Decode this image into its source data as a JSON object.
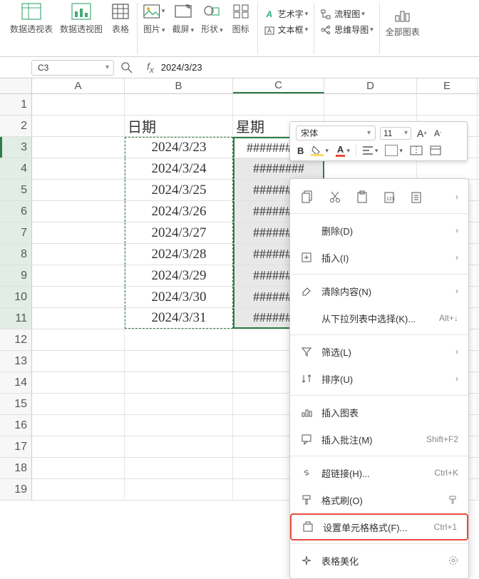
{
  "ribbon": {
    "pivot_table": "数据透视表",
    "pivot_chart": "数据透视图",
    "table": "表格",
    "picture": "图片",
    "screenshot": "截屏",
    "shapes": "形状",
    "icons": "图标",
    "wordart": "艺术字",
    "textbox": "文本框",
    "flowchart": "流程图",
    "mindmap": "思维导图",
    "all_charts": "全部图表"
  },
  "name_box": "C3",
  "formula_value": "2024/3/23",
  "columns": [
    "A",
    "B",
    "C",
    "D",
    "E"
  ],
  "rows": [
    {
      "n": 1
    },
    {
      "n": 2,
      "B": "日期",
      "C": "星期",
      "header": true
    },
    {
      "n": 3,
      "B": "2024/3/23",
      "C": "##########"
    },
    {
      "n": 4,
      "B": "2024/3/24",
      "C": "########"
    },
    {
      "n": 5,
      "B": "2024/3/25",
      "C": "########"
    },
    {
      "n": 6,
      "B": "2024/3/26",
      "C": "########"
    },
    {
      "n": 7,
      "B": "2024/3/27",
      "C": "########"
    },
    {
      "n": 8,
      "B": "2024/3/28",
      "C": "########"
    },
    {
      "n": 9,
      "B": "2024/3/29",
      "C": "########"
    },
    {
      "n": 10,
      "B": "2024/3/30",
      "C": "########"
    },
    {
      "n": 11,
      "B": "2024/3/31",
      "C": "########"
    },
    {
      "n": 12
    },
    {
      "n": 13
    },
    {
      "n": 14
    },
    {
      "n": 15
    },
    {
      "n": 16
    },
    {
      "n": 17
    },
    {
      "n": 18
    },
    {
      "n": 19
    }
  ],
  "mini": {
    "font": "宋体",
    "size": "11",
    "bold": "B"
  },
  "menu": {
    "delete": "删除(D)",
    "insert": "插入(I)",
    "clear": "清除内容(N)",
    "dropdown_select": "从下拉列表中选择(K)...",
    "dropdown_select_sc": "Alt+↓",
    "filter": "筛选(L)",
    "sort": "排序(U)",
    "insert_chart": "插入图表",
    "insert_comment": "插入批注(M)",
    "insert_comment_sc": "Shift+F2",
    "hyperlink": "超链接(H)...",
    "hyperlink_sc": "Ctrl+K",
    "format_painter": "格式刷(O)",
    "cell_format": "设置单元格格式(F)...",
    "cell_format_sc": "Ctrl+1",
    "beautify": "表格美化"
  }
}
